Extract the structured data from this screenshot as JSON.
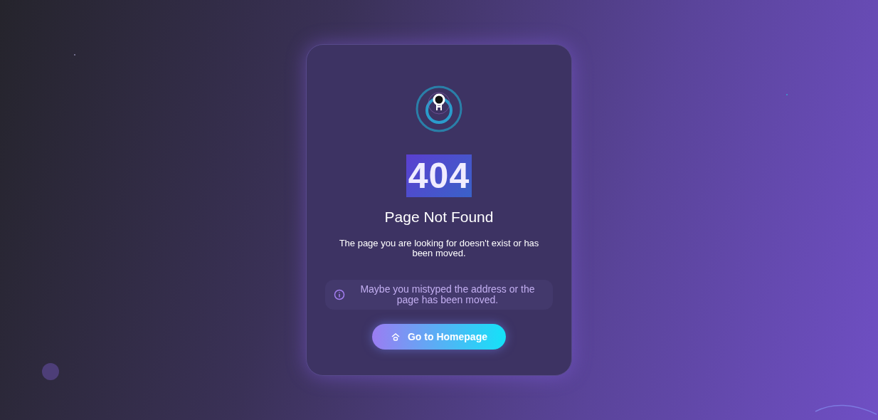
{
  "card": {
    "code": "404",
    "title": "Page Not Found",
    "message": "The page you are looking for doesn't exist or has been moved.",
    "hint": "Maybe you mistyped the address or the page has been moved.",
    "button": "Go to Homepage"
  }
}
